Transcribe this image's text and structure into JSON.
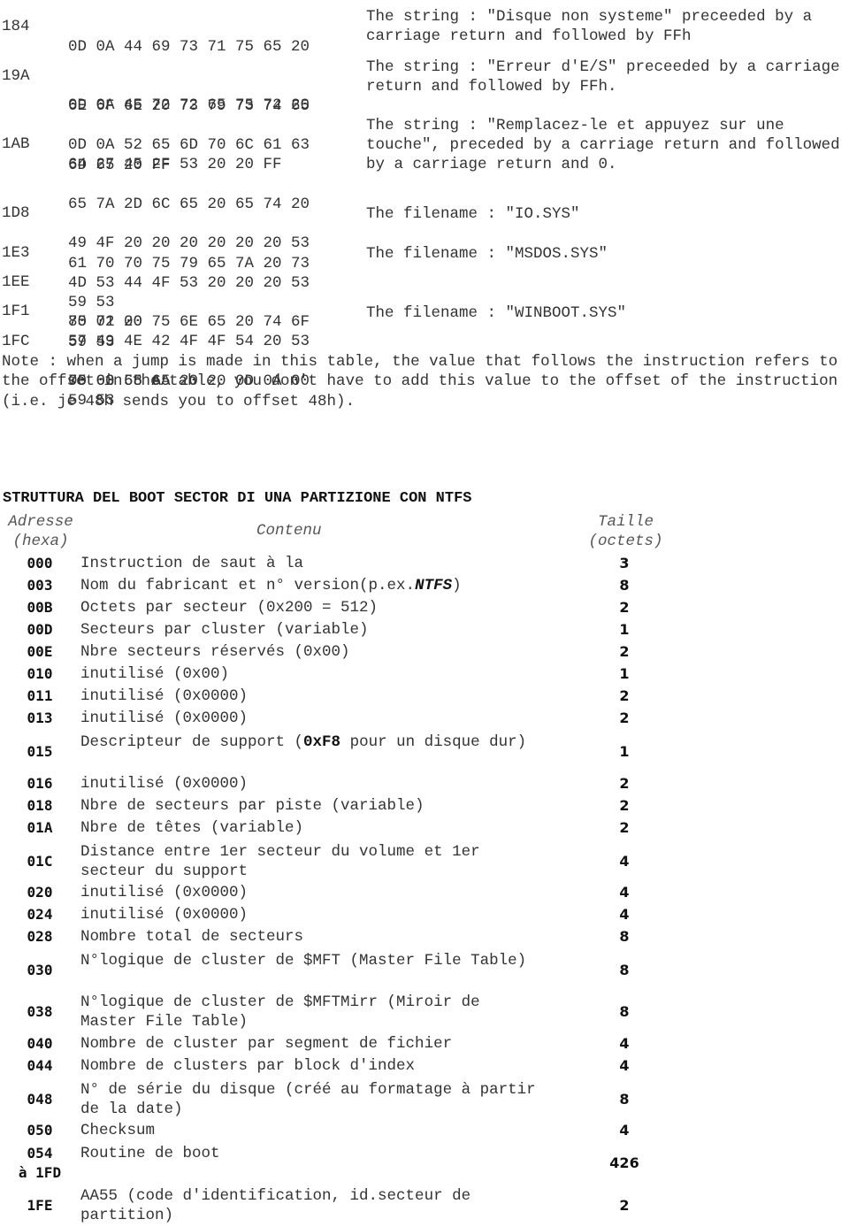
{
  "hex_table": {
    "rows": [
      {
        "offset": "184",
        "bytes": [
          "0D 0A 44 69 73 71 75 65 20",
          "6E 6F 6E 20 73 79 73 74 65",
          "6D 65 20 FF"
        ],
        "description": "The string : \"Disque non systeme\" preceeded by a carriage return and followed by FFh"
      },
      {
        "offset": "19A",
        "bytes": [
          "0D 0A 45 72 72 65 75 72 20",
          "64 27 45 2F 53 20 20 FF"
        ],
        "description": "The string : \"Erreur d'E/S\" preceeded by a carriage return and followed by FFh."
      },
      {
        "offset": "1AB",
        "bytes": [
          "0D 0A 52 65 6D 70 6C 61 63",
          "65 7A 2D 6C 65 20 65 74 20",
          "61 70 70 75 79 65 7A 20 73",
          "75 72 20 75 6E 65 20 74 6F",
          "75 63 68 65 20 20 0D 0A 00"
        ],
        "description": "The string : \"Remplacez-le et appuyez sur une touche\", preceded by a carriage return and followed by a carriage return and 0."
      },
      {
        "offset": "1D8",
        "bytes": [
          "49 4F 20 20 20 20 20 20 53",
          "59 53"
        ],
        "description": "The filename : \"IO.SYS\""
      },
      {
        "offset": "1E3",
        "bytes": [
          "4D 53 44 4F 53 20 20 20 53",
          "59 53"
        ],
        "description": "The filename : \"MSDOS.SYS\""
      },
      {
        "offset": "1EE",
        "bytes": [
          "80 01 00"
        ],
        "description": ""
      },
      {
        "offset": "1F1",
        "bytes": [
          "57 49 4E 42 4F 4F 54 20 53",
          "59 53"
        ],
        "description": "The filename : \"WINBOOT.SYS\""
      },
      {
        "offset": "1FC",
        "bytes": [
          "00 00 55 AA"
        ],
        "description": ""
      }
    ],
    "note": "Note : when a jump is made in this table, the value that follows the instruction refers to the offset in the table, you don't have to add this value to the offset of the instruction (i.e. je 48h sends you to offset 48h)."
  },
  "ntfs_section": {
    "title": "STRUTTURA DEL BOOT SECTOR DI UNA PARTIZIONE CON NTFS",
    "headers": {
      "address_line1": "Adresse",
      "address_line2": "(hexa)",
      "content": "Contenu",
      "size_line1": "Taille",
      "size_line2": "(octets)"
    },
    "rows": [
      {
        "address": "000",
        "content": "Instruction de saut à la",
        "size": "3"
      },
      {
        "address": "003",
        "content_pre": "Nom du fabricant et n° version(p.ex.",
        "content_bold_italic": "NTFS",
        "content_post": ")",
        "size": "8"
      },
      {
        "address": "00B",
        "content": "Octets par secteur (0x200 = 512)",
        "size": "2"
      },
      {
        "address": "00D",
        "content": "Secteurs par cluster (variable)",
        "size": "1"
      },
      {
        "address": "00E",
        "content": "Nbre secteurs réservés (0x00)",
        "size": "2"
      },
      {
        "address": "010",
        "content": "inutilisé (0x00)",
        "size": "1"
      },
      {
        "address": "011",
        "content": "inutilisé (0x0000)",
        "size": "2"
      },
      {
        "address": "013",
        "content": "inutilisé (0x0000)",
        "size": "2"
      },
      {
        "address": "015",
        "content_pre": "Descripteur de support (",
        "content_bold": "0xF8",
        "content_post": " pour un disque dur)",
        "size": "1"
      },
      {
        "address": "016",
        "content": "inutilisé (0x0000)",
        "size": "2"
      },
      {
        "address": "018",
        "content": "Nbre de secteurs par piste (variable)",
        "size": "2"
      },
      {
        "address": "01A",
        "content": "Nbre de têtes (variable)",
        "size": "2"
      },
      {
        "address": "01C",
        "content": "Distance entre 1er secteur du volume et 1er secteur du support",
        "size": "4"
      },
      {
        "address": "020",
        "content": "inutilisé (0x0000)",
        "size": "4"
      },
      {
        "address": "024",
        "content": "inutilisé (0x0000)",
        "size": "4"
      },
      {
        "address": "028",
        "content": "Nombre total de secteurs",
        "size": "8"
      },
      {
        "address": "030",
        "content": "N°logique de cluster de $MFT (Master File Table)",
        "size": "8"
      },
      {
        "address": "038",
        "content": "N°logique de cluster de $MFTMirr (Miroir de Master File Table)",
        "size": "8"
      },
      {
        "address": "040",
        "content": "Nombre de cluster par segment de fichier",
        "size": "4"
      },
      {
        "address": "044",
        "content": "Nombre de clusters par block d'index",
        "size": "4"
      },
      {
        "address": "048",
        "content": "N° de série du disque (créé au formatage à partir de la date)",
        "size": "8"
      },
      {
        "address": "050",
        "content": "Checksum",
        "size": "4"
      },
      {
        "address": "054",
        "address_line2": "à 1FD",
        "content": "Routine de boot",
        "size": "426"
      },
      {
        "address": "1FE",
        "content": "AA55 (code d'identification, id.secteur de partition)",
        "size": "2"
      }
    ]
  }
}
